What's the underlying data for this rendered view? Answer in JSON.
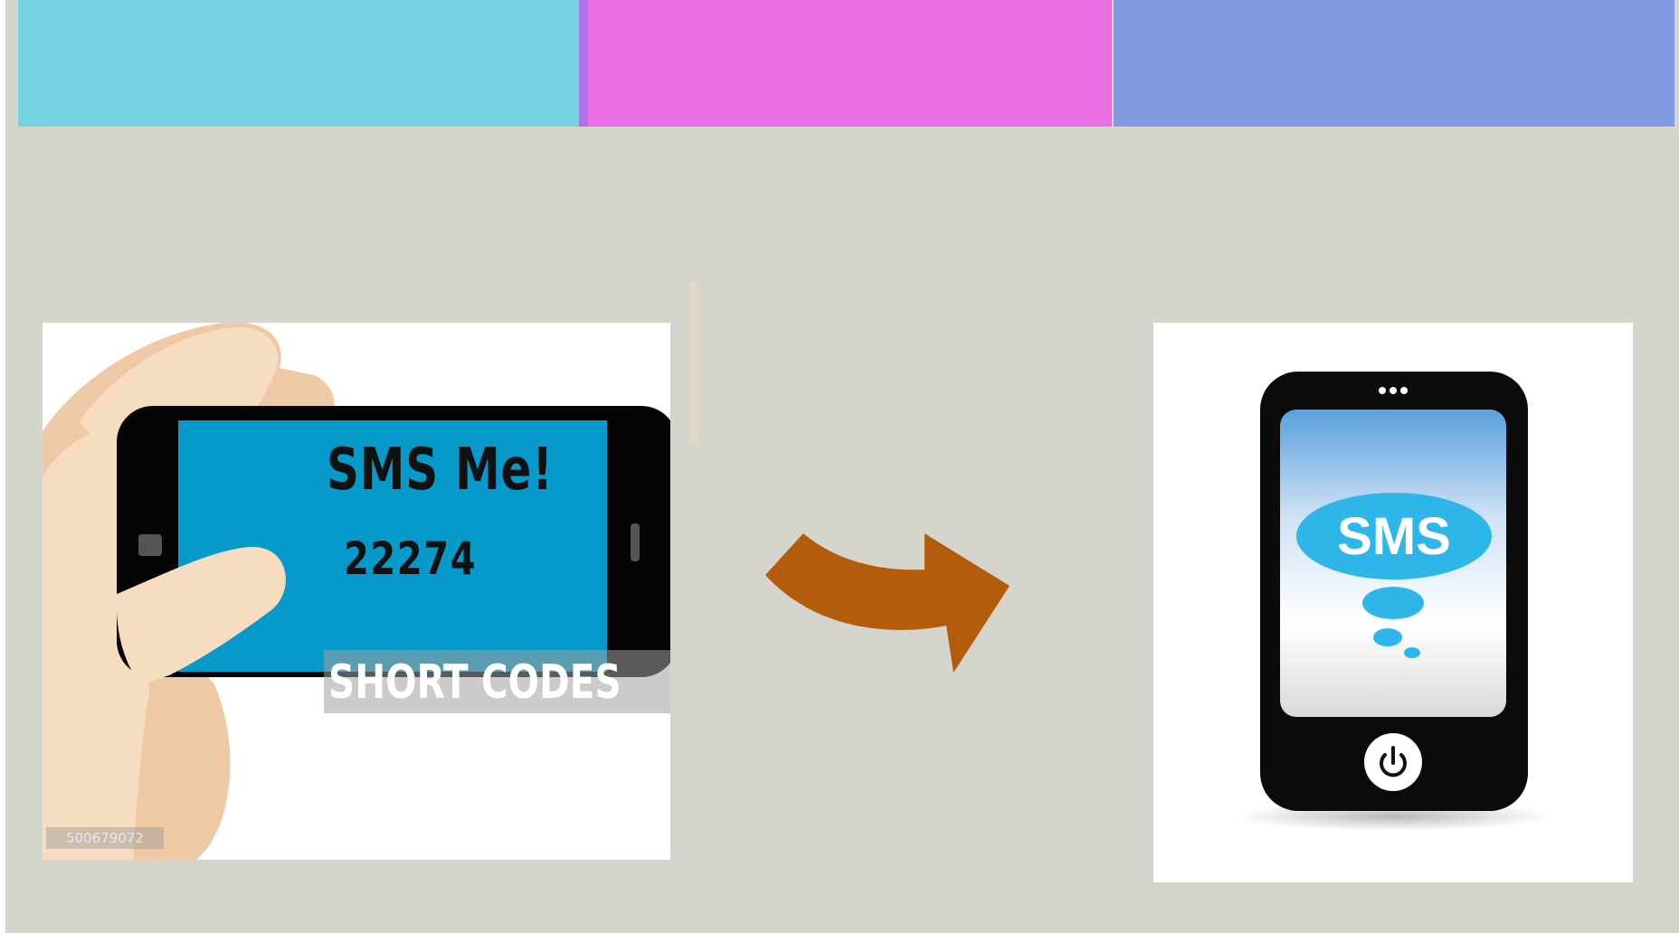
{
  "slide": {
    "colors": {
      "background": "#d5d5cd",
      "bar_cyan": "#74d2e1",
      "bar_pink": "#e870e3",
      "bar_blue": "#819be3",
      "arrow": "#b35c0c",
      "phone_screen": "#069acb"
    }
  },
  "left_image": {
    "heading": "SMS Me!",
    "number": "22274",
    "caption": "SHORT CODES",
    "stock_id": "500679072"
  },
  "right_image": {
    "bubble_text": "SMS",
    "button_icon": "power-icon"
  },
  "arrow": {
    "icon": "curved-arrow-right-icon"
  }
}
